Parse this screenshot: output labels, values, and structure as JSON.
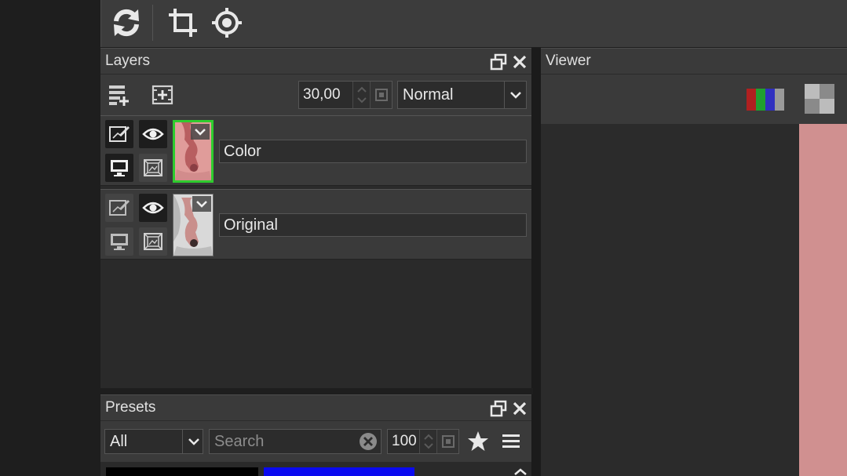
{
  "toolbar": {
    "icons": [
      "refresh-icon",
      "crop-icon",
      "target-icon"
    ]
  },
  "layers": {
    "title": "Layers",
    "opacity": "30,00",
    "blend_mode": "Normal",
    "items": [
      {
        "name": "Color",
        "selected": true,
        "thumb_color": "#e0a0a0"
      },
      {
        "name": "Original",
        "selected": false,
        "thumb_color": "#d8d8d8"
      }
    ]
  },
  "presets": {
    "title": "Presets",
    "category": "All",
    "search_placeholder": "Search",
    "strength": "100",
    "swatches": [
      "#000000",
      "#0a0af0"
    ]
  },
  "viewer": {
    "title": "Viewer"
  },
  "colors": {
    "accent_selected": "#2ecc2e",
    "image_pink": "#d09090"
  }
}
